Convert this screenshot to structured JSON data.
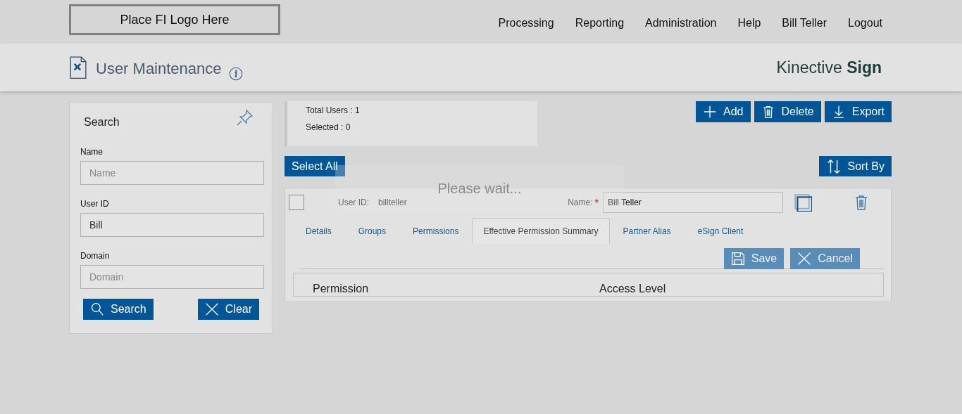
{
  "header": {
    "logo": "Place FI Logo Here",
    "nav": [
      {
        "label": "Processing"
      },
      {
        "label": "Reporting"
      },
      {
        "label": "Administration"
      },
      {
        "label": "Help"
      },
      {
        "label": "Bill Teller"
      },
      {
        "label": "Logout"
      }
    ]
  },
  "page": {
    "title": "User Maintenance",
    "brand": "Kinective **Sign**"
  },
  "search_panel": {
    "title": "Search",
    "fields": [
      {
        "label": "Name",
        "placeholder": "Name"
      },
      {
        "label": "User ID",
        "value": "Bill"
      },
      {
        "label": "Domain",
        "placeholder": "Domain"
      }
    ],
    "buttons": [
      {
        "label": "Search",
        "kind": "search"
      },
      {
        "label": "Clear",
        "kind": "clear"
      }
    ]
  },
  "summary": {
    "total": "Total Users : 1",
    "selected": "Selected : 0"
  },
  "toolbar": [
    {
      "label": "Add",
      "kind": "add"
    },
    {
      "label": "Delete",
      "kind": "delete"
    },
    {
      "label": "Export",
      "kind": "export"
    }
  ],
  "select_all": "Select All",
  "sort_by": "Sort By",
  "user_card": {
    "checked": false,
    "user_id_label": "User ID:",
    "user_id": "billteller",
    "name_label": "Name:",
    "required_mark": "*",
    "name": "Bill Teller",
    "tabs": [
      {
        "label": "Details",
        "selected": false
      },
      {
        "label": "Groups",
        "selected": false
      },
      {
        "label": "Permissions",
        "selected": false
      },
      {
        "label": "Effective Permission Summary",
        "selected": true
      },
      {
        "label": "Partner Alias",
        "selected": false
      },
      {
        "label": "eSign Client",
        "selected": false
      }
    ],
    "actions": [
      {
        "label": "Save",
        "kind": "save",
        "disabled": true
      },
      {
        "label": "Cancel",
        "kind": "cancel",
        "disabled": true
      }
    ],
    "table": {
      "columns": [
        "Permission",
        "Access Level"
      ]
    }
  },
  "overlay": {
    "text": "Please wait..."
  }
}
